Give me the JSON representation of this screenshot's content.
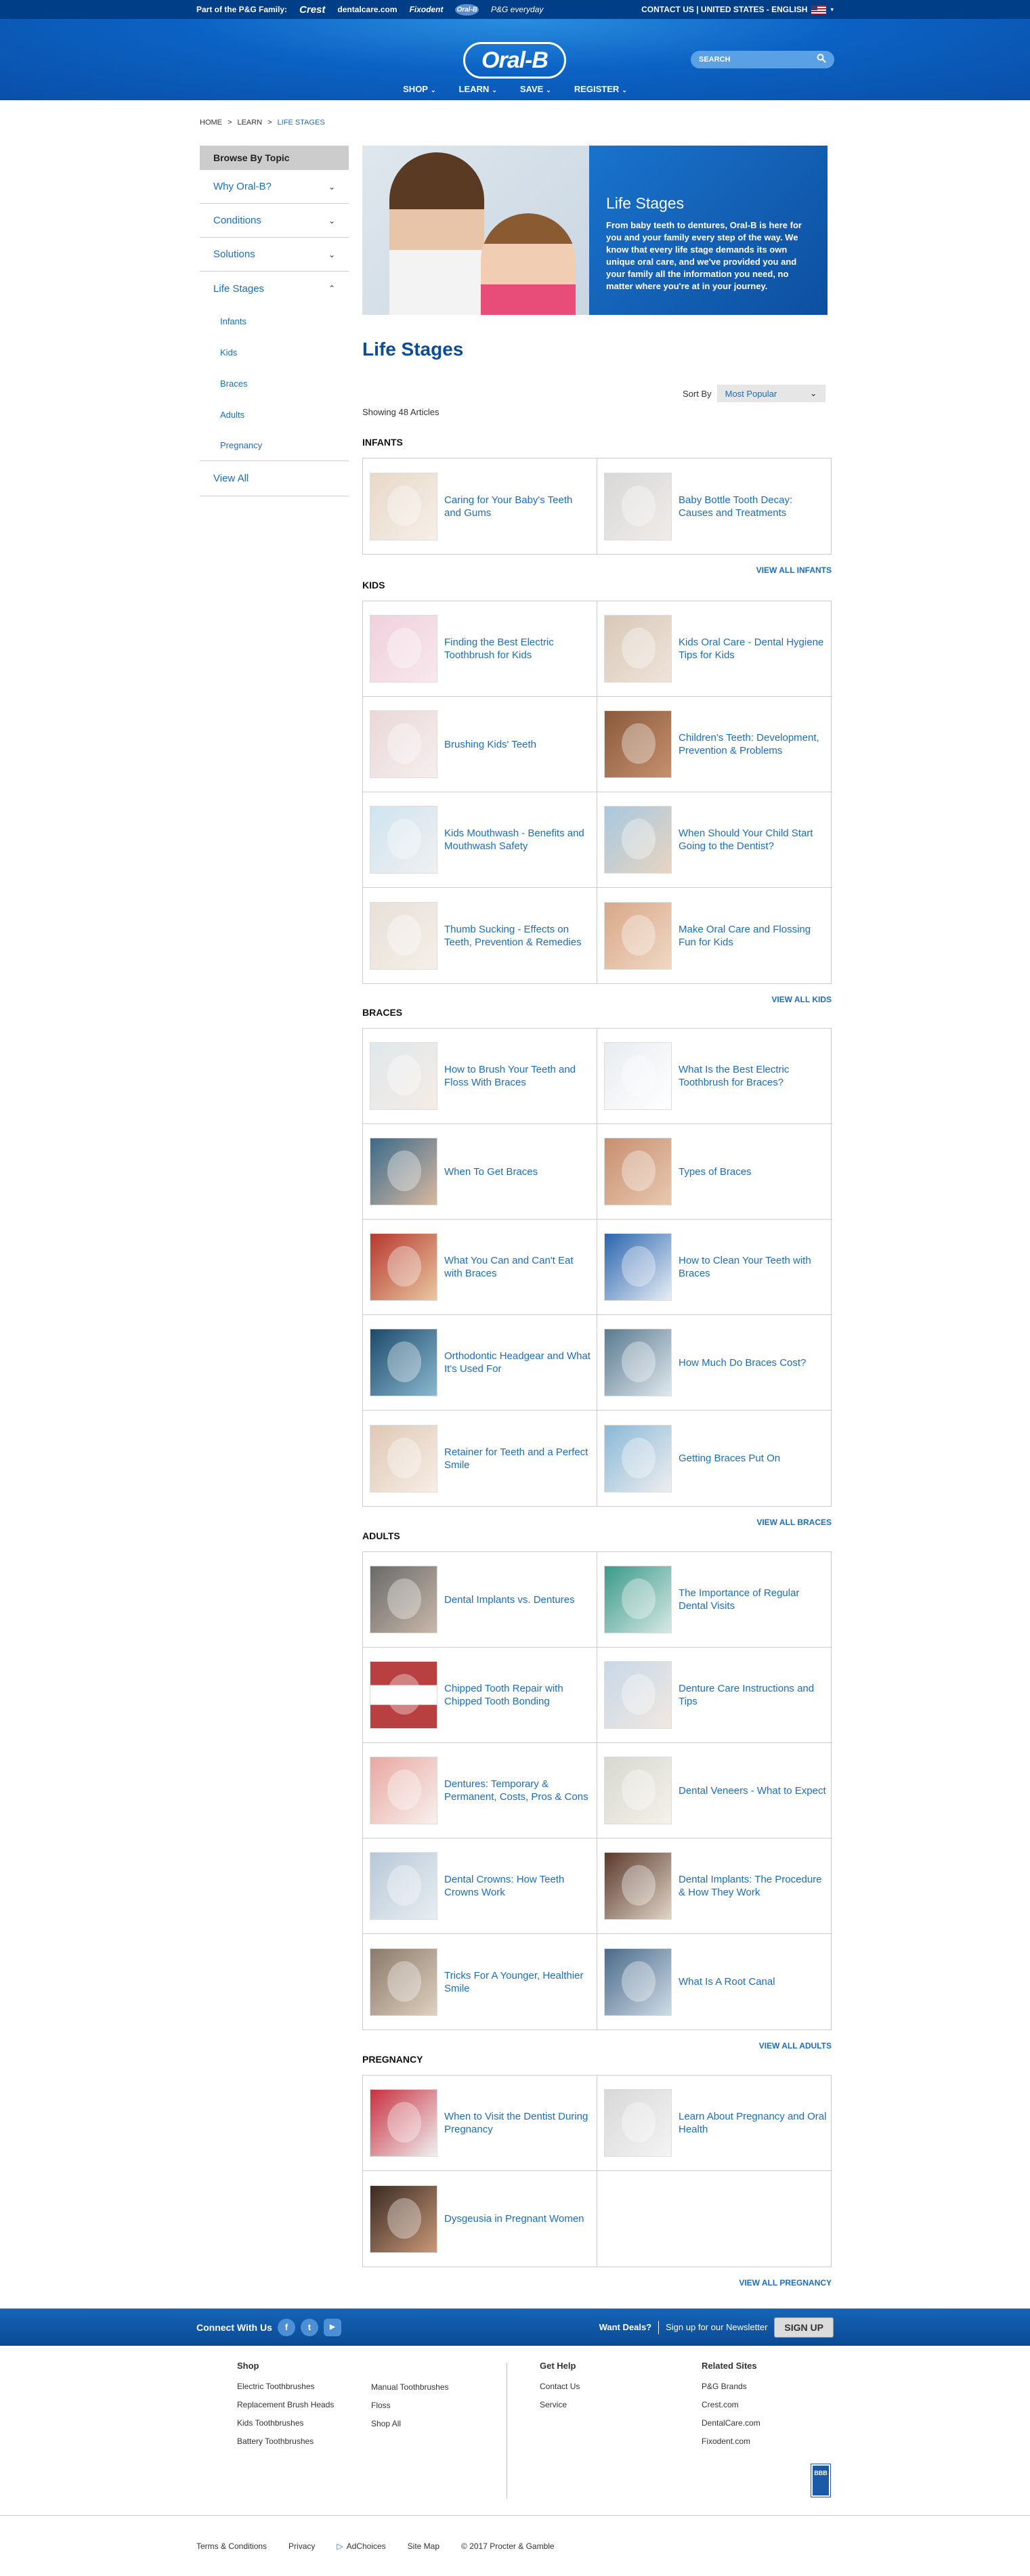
{
  "topbar": {
    "pg_family": "Part of the P&G Family:",
    "brands": [
      "Crest",
      "dentalcare.com",
      "Fixodent",
      "Oral-B",
      "P&G everyday"
    ],
    "contact": "CONTACT US | UNITED STATES - ENGLISH"
  },
  "header": {
    "logo": "Oral-B",
    "search_placeholder": "SEARCH",
    "nav": [
      "SHOP",
      "LEARN",
      "SAVE",
      "REGISTER"
    ]
  },
  "breadcrumb": [
    "HOME",
    ">",
    "LEARN",
    ">",
    "LIFE STAGES"
  ],
  "sidebar": {
    "header": "Browse By Topic",
    "topics": [
      {
        "label": "Why Oral-B?",
        "chev": "⌄"
      },
      {
        "label": "Conditions",
        "chev": "⌄"
      },
      {
        "label": "Solutions",
        "chev": "⌄"
      },
      {
        "label": "Life Stages",
        "chev": "⌃"
      }
    ],
    "subs": [
      "Infants",
      "Kids",
      "Braces",
      "Adults",
      "Pregnancy"
    ],
    "view_all": "View All"
  },
  "hero": {
    "title": "Life Stages",
    "text": "From baby teeth to dentures, Oral-B is here for you and your family every step of the way. We know that every life stage demands its own unique oral care, and we've provided you and your family all the information you need, no matter where you're at in your journey."
  },
  "page_title": "Life Stages",
  "sort": {
    "label": "Sort By",
    "value": "Most Popular"
  },
  "showing": "Showing 48 Articles",
  "sections": {
    "infants": {
      "title": "INFANTS",
      "view_all": "VIEW ALL INFANTS",
      "items": [
        "Caring for Your Baby's Teeth and Gums",
        "Baby Bottle Tooth Decay: Causes and Treatments"
      ]
    },
    "kids": {
      "title": "KIDS",
      "view_all": "VIEW ALL KIDS",
      "items": [
        "Finding the Best Electric Toothbrush for Kids",
        "Kids Oral Care - Dental Hygiene Tips for Kids",
        "Brushing Kids' Teeth",
        "Children's Teeth: Development, Prevention & Problems",
        "Kids Mouthwash - Benefits and Mouthwash Safety",
        "When Should Your Child Start Going to the Dentist?",
        "Thumb Sucking - Effects on Teeth, Prevention & Remedies",
        "Make Oral Care and Flossing Fun for Kids"
      ]
    },
    "braces": {
      "title": "BRACES",
      "view_all": "VIEW ALL BRACES",
      "items": [
        "How to Brush Your Teeth and Floss With Braces",
        "What Is the Best Electric Toothbrush for Braces?",
        "When To Get Braces",
        "Types of Braces",
        "What You Can and Can't Eat with Braces",
        "How to Clean Your Teeth with Braces",
        "Orthodontic Headgear and What It's Used For",
        "How Much Do Braces Cost?",
        "Retainer for Teeth and a Perfect Smile",
        "Getting Braces Put On"
      ]
    },
    "adults": {
      "title": "ADULTS",
      "view_all": "VIEW ALL ADULTS",
      "items": [
        "Dental Implants vs. Dentures",
        "The Importance of Regular Dental Visits",
        "Chipped Tooth Repair with Chipped Tooth Bonding",
        "Denture Care Instructions and Tips",
        "Dentures: Temporary & Permanent, Costs, Pros & Cons",
        "Dental Veneers - What to Expect",
        "Dental Crowns: How Teeth Crowns Work",
        "Dental Implants: The Procedure & How They Work",
        "Tricks For A Younger, Healthier Smile",
        "What Is A Root Canal"
      ]
    },
    "pregnancy": {
      "title": "PREGNANCY",
      "view_all": "VIEW ALL PREGNANCY",
      "items": [
        "When to Visit the Dentist During Pregnancy",
        "Learn About Pregnancy and Oral Health",
        "Dysgeusia in Pregnant Women"
      ]
    }
  },
  "connect": {
    "label": "Connect With Us",
    "social": [
      "f",
      "t",
      "▶"
    ],
    "deals": "Want Deals?",
    "signup": "Sign up for our Newsletter",
    "button": "SIGN UP"
  },
  "footer": {
    "shop": {
      "title": "Shop",
      "col1": [
        "Electric Toothbrushes",
        "Replacement Brush Heads",
        "Kids Toothbrushes",
        "Battery Toothbrushes"
      ],
      "col2": [
        "Manual Toothbrushes",
        "Floss",
        "Shop All"
      ]
    },
    "help": {
      "title": "Get Help",
      "links": [
        "Contact Us",
        "Service"
      ]
    },
    "related": {
      "title": "Related Sites",
      "links": [
        "P&G Brands",
        "Crest.com",
        "DentalCare.com",
        "Fixodent.com"
      ]
    },
    "bbb": "BBB"
  },
  "bottom": {
    "terms": "Terms & Conditions",
    "privacy": "Privacy",
    "adchoices": "AdChoices",
    "sitemap": "Site Map",
    "copyright": "© 2017 Procter & Gamble"
  },
  "colors": {
    "primary": "#0b62c4",
    "link": "#1a6ec2",
    "title": "#0b4d95"
  }
}
